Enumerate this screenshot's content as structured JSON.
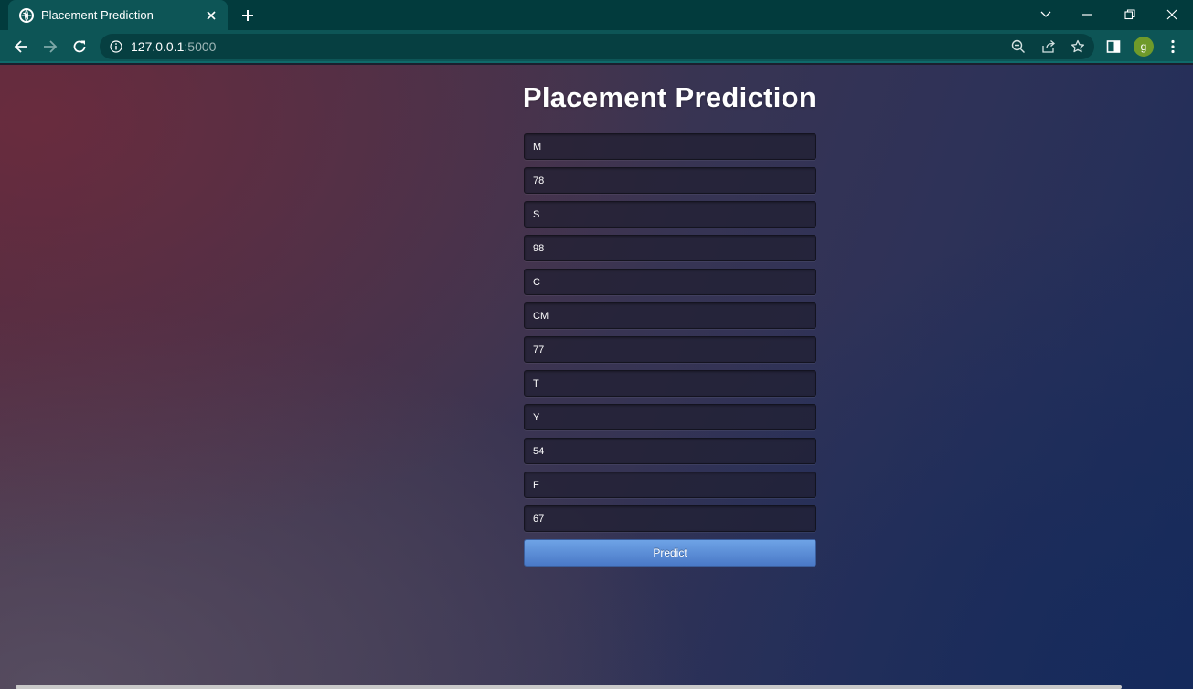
{
  "browser": {
    "tab_title": "Placement Prediction",
    "url_host": "127.0.0.1",
    "url_port": ":5000",
    "profile_initial": "g"
  },
  "page": {
    "title": "Placement Prediction",
    "fields": [
      "M",
      "78",
      "S",
      "98",
      "C",
      "CM",
      "77",
      "T",
      "Y",
      "54",
      "F",
      "67"
    ],
    "submit_label": "Predict"
  },
  "colors": {
    "chrome_dark": "#023b3d",
    "chrome_teal": "#0d5556",
    "button_blue": "#5a8fd8"
  },
  "icons": [
    "globe-icon",
    "close-icon",
    "plus-icon",
    "chevron-down-icon",
    "minimize-icon",
    "restore-icon",
    "back-arrow-icon",
    "forward-arrow-icon",
    "reload-icon",
    "info-icon",
    "zoom-out-icon",
    "share-icon",
    "star-icon",
    "side-panel-icon",
    "more-vert-icon"
  ]
}
